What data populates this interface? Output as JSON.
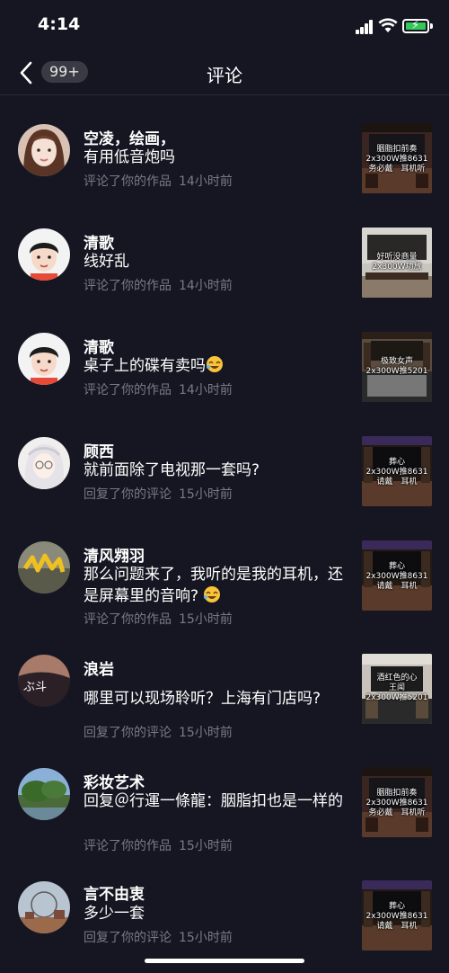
{
  "status_bar": {
    "time": "4:14"
  },
  "nav": {
    "badge": "99+",
    "title": "评论"
  },
  "items": [
    {
      "name": "空凌，绘画，",
      "comment": "有用低音炮吗",
      "action": "评论了你的作品",
      "time": "14小时前",
      "thumb_text": "胭脂扣前奏\n2x300W推8631\n务必戴　耳机听"
    },
    {
      "name": "清歌",
      "comment": "线好乱",
      "action": "评论了你的作品",
      "time": "14小时前",
      "thumb_text": "好听没商量\n2x300W功放"
    },
    {
      "name": "清歌",
      "comment": "桌子上的碟有卖吗",
      "action": "评论了你的作品",
      "time": "14小时前",
      "thumb_text": "极致女声\n2x300W推5201"
    },
    {
      "name": "顾西",
      "comment": "就前面除了电视那一套吗?",
      "action": "回复了你的评论",
      "time": "15小时前",
      "thumb_text": "葬心\n2x300W推8631\n请戴　耳机"
    },
    {
      "name": "清风翙羽",
      "comment": "那么问题来了，我听的是我的耳机，还是屏幕里的音响?",
      "action": "评论了你的作品",
      "time": "15小时前",
      "thumb_text": "葬心\n2x300W推8631\n请戴　耳机"
    },
    {
      "name": "浪岩",
      "comment": "哪里可以现场聆听？上海有门店吗?",
      "action": "回复了你的评论",
      "time": "15小时前",
      "thumb_text": "酒红色的心\n王闻\n2x300W推5201"
    },
    {
      "name": "彩妆艺术",
      "comment": "回复＠行運一條龍：胭脂扣也是一样的",
      "action": "评论了你的作品",
      "time": "15小时前",
      "thumb_text": "胭脂扣前奏\n2x300W推8631\n务必戴　耳机听"
    },
    {
      "name": "言不由衷",
      "comment": "多少一套",
      "action": "回复了你的评论",
      "time": "15小时前",
      "thumb_text": "葬心\n2x300W推8631\n请戴　耳机"
    }
  ]
}
